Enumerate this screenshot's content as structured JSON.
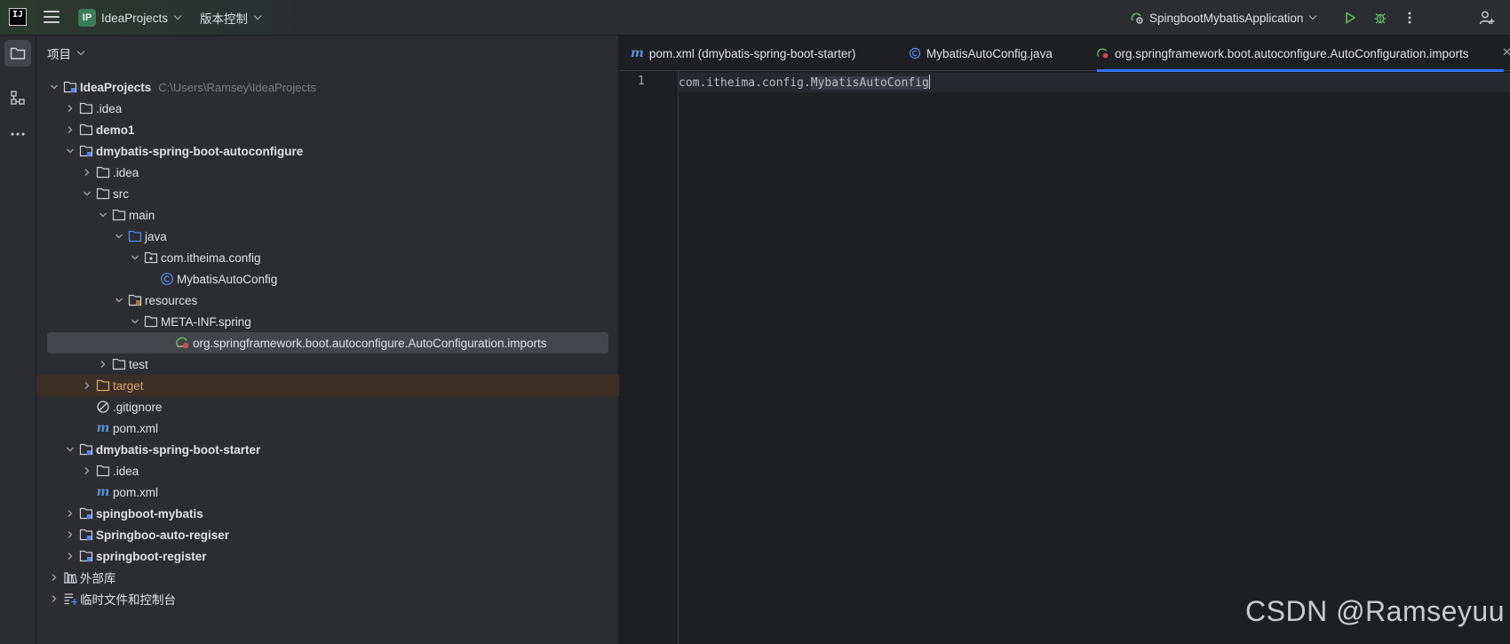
{
  "topbar": {
    "logo_text": "IJ",
    "project_badge": "IP",
    "project_name": "IdeaProjects",
    "vcs_label": "版本控制",
    "run_config": "SpingbootMybatisApplication"
  },
  "panel": {
    "title": "项目"
  },
  "tree": [
    {
      "label": "IdeaProjects",
      "hint": "C:\\Users\\Ramsey\\IdeaProjects"
    },
    {
      "label": ".idea"
    },
    {
      "label": "demo1"
    },
    {
      "label": "dmybatis-spring-boot-autoconfigure"
    },
    {
      "label": ".idea"
    },
    {
      "label": "src"
    },
    {
      "label": "main"
    },
    {
      "label": "java"
    },
    {
      "label": "com.itheima.config"
    },
    {
      "label": "MybatisAutoConfig"
    },
    {
      "label": "resources"
    },
    {
      "label": "META-INF.spring"
    },
    {
      "label": "org.springframework.boot.autoconfigure.AutoConfiguration.imports"
    },
    {
      "label": "test"
    },
    {
      "label": "target"
    },
    {
      "label": ".gitignore"
    },
    {
      "label": "pom.xml"
    },
    {
      "label": "dmybatis-spring-boot-starter"
    },
    {
      "label": ".idea"
    },
    {
      "label": "pom.xml"
    },
    {
      "label": "spingboot-mybatis"
    },
    {
      "label": "Springboo-auto-regiser"
    },
    {
      "label": "springboot-register"
    },
    {
      "label": "外部库"
    },
    {
      "label": "临时文件和控制台"
    }
  ],
  "tabs": [
    {
      "label": "pom.xml (dmybatis-spring-boot-starter)"
    },
    {
      "label": "MybatisAutoConfig.java"
    },
    {
      "label": "org.springframework.boot.autoconfigure.AutoConfiguration.imports"
    }
  ],
  "editor": {
    "line_number": "1",
    "code_prefix": "com.itheima.config.",
    "code_highlight": "MybatisAutoConfig"
  },
  "watermark": "CSDN @Ramseyuu",
  "colors": {
    "accent": "#3574f0",
    "run_green": "#5fb865",
    "folder_blue": "#548af7",
    "excluded_bg": "#3b2e25"
  }
}
